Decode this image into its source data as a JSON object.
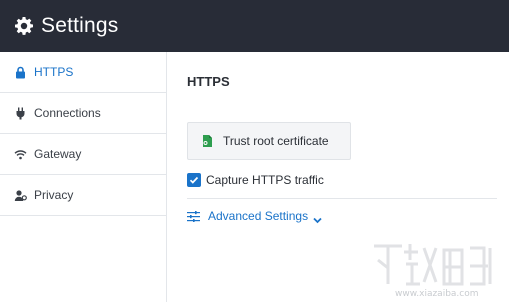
{
  "header": {
    "title": "Settings"
  },
  "sidebar": {
    "items": [
      {
        "label": "HTTPS",
        "icon": "lock-icon",
        "active": true
      },
      {
        "label": "Connections",
        "icon": "plug-icon",
        "active": false
      },
      {
        "label": "Gateway",
        "icon": "wifi-icon",
        "active": false
      },
      {
        "label": "Privacy",
        "icon": "user-secret-icon",
        "active": false
      }
    ]
  },
  "main": {
    "section_title": "HTTPS",
    "trust_button_label": "Trust root certificate",
    "capture_label": "Capture HTTPS traffic",
    "capture_checked": true,
    "advanced_label": "Advanced Settings"
  },
  "watermark": {
    "url": "www.xiazaiba.com"
  },
  "colors": {
    "header_bg": "#282c37",
    "accent": "#1a73c9",
    "cert_green": "#2e9e4f"
  }
}
